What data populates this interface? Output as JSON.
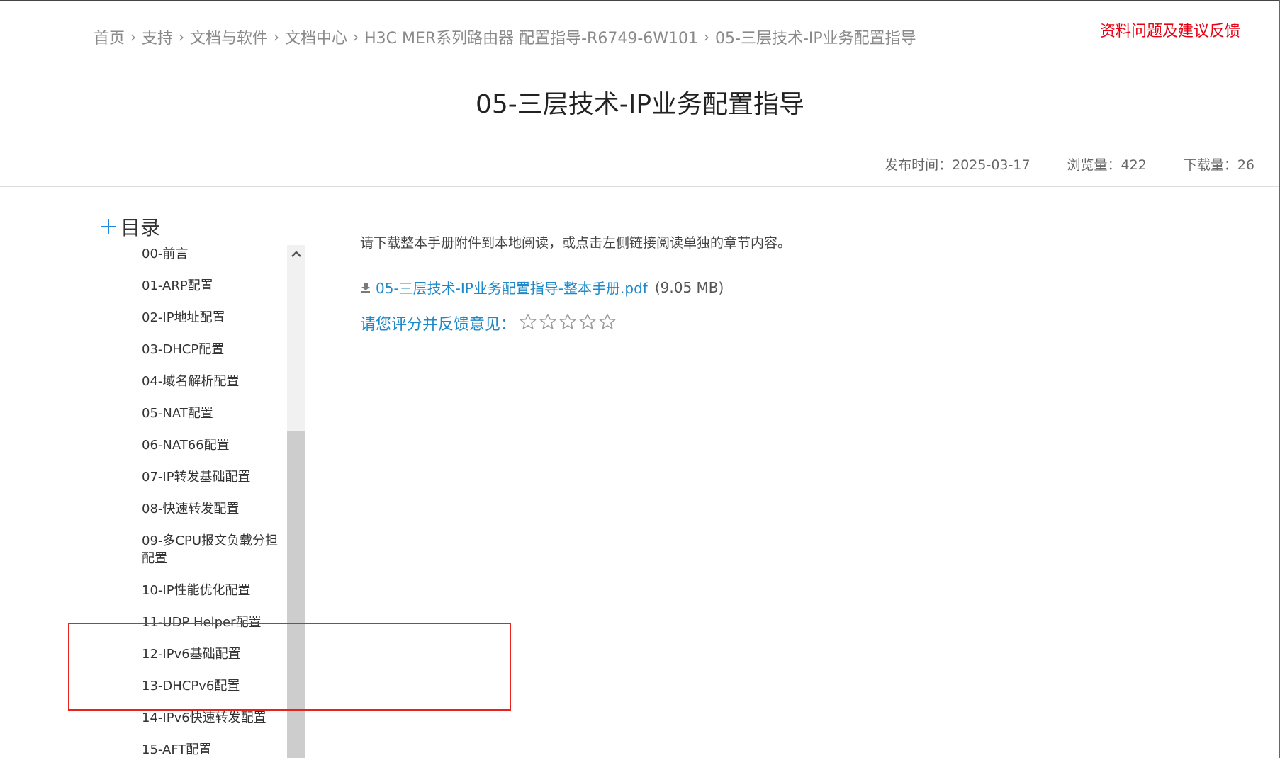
{
  "breadcrumb": {
    "items": [
      "首页",
      "支持",
      "文档与软件",
      "文档中心",
      "H3C MER系列路由器 配置指导-R6749-6W101",
      "05-三层技术-IP业务配置指导"
    ],
    "separator": "›"
  },
  "header": {
    "feedback_link": "资料问题及建议反馈",
    "title": "05-三层技术-IP业务配置指导"
  },
  "meta": {
    "publish": "发布时间：2025-03-17",
    "views": "浏览量：422",
    "downloads": "下载量：26"
  },
  "toc": {
    "title": "目录",
    "items": [
      "00-前言",
      "01-ARP配置",
      "02-IP地址配置",
      "03-DHCP配置",
      "04-域名解析配置",
      "05-NAT配置",
      "06-NAT66配置",
      "07-IP转发基础配置",
      "08-快速转发配置",
      "09-多CPU报文负载分担配置",
      "10-IP性能优化配置",
      "11-UDP Helper配置",
      "12-IPv6基础配置",
      "13-DHCPv6配置",
      "14-IPv6快速转发配置",
      "15-AFT配置"
    ]
  },
  "main": {
    "intro": "请下载整本手册附件到本地阅读，或点击左侧链接阅读单独的章节内容。",
    "download_link": "05-三层技术-IP业务配置指导-整本手册.pdf",
    "file_size": "(9.05 MB)",
    "rating_label": "请您评分并反馈意见：",
    "rating_value": 0,
    "rating_max": 5
  },
  "colors": {
    "accent_blue": "#1e88c8",
    "feedback_red": "#e60012",
    "annotation_red": "#e8231b"
  },
  "icons": {
    "download": "download-icon",
    "star": "star-outline-icon",
    "plus": "plus-icon",
    "scroll_up": "chevron-up-icon"
  }
}
